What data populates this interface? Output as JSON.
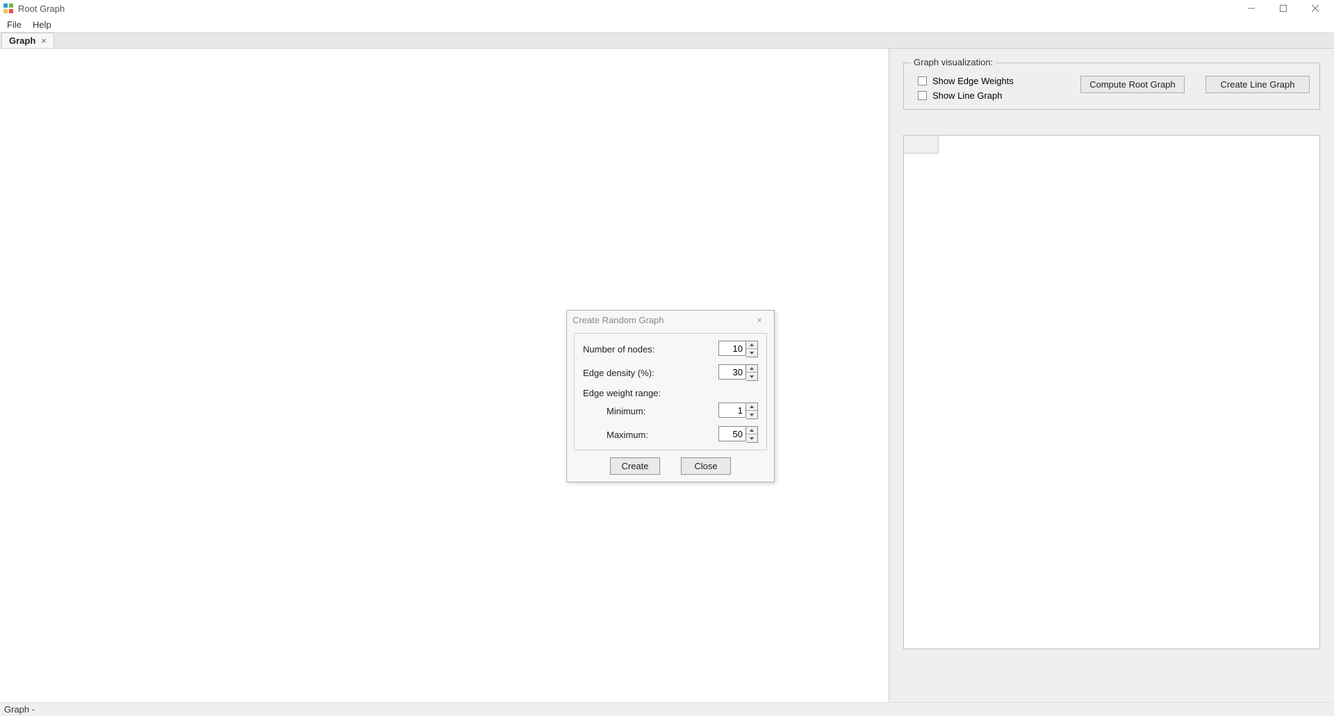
{
  "window": {
    "title": "Root Graph"
  },
  "menu": {
    "file": "File",
    "help": "Help"
  },
  "tabs": {
    "active": {
      "label": "Graph"
    }
  },
  "sidepanel": {
    "visualization": {
      "legend": "Graph visualization:",
      "show_edge_weights": "Show Edge Weights",
      "show_line_graph": "Show Line Graph",
      "compute_root_graph": "Compute Root Graph",
      "create_line_graph": "Create Line Graph"
    }
  },
  "dialog": {
    "title": "Create Random Graph",
    "fields": {
      "num_nodes_label": "Number of nodes:",
      "num_nodes_value": "10",
      "edge_density_label": "Edge density (%):",
      "edge_density_value": "30",
      "edge_weight_range_label": "Edge weight range:",
      "min_label": "Minimum:",
      "min_value": "1",
      "max_label": "Maximum:",
      "max_value": "50"
    },
    "buttons": {
      "create": "Create",
      "close": "Close"
    }
  },
  "statusbar": {
    "text": "Graph  -"
  }
}
